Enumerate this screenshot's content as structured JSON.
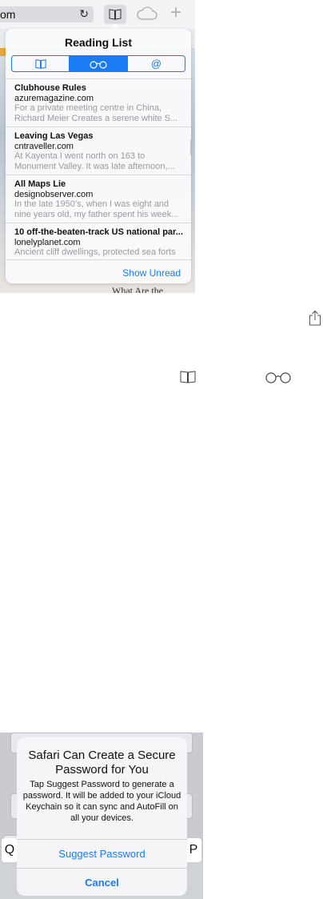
{
  "browser": {
    "url_text": "om",
    "reload_symbol": "↻"
  },
  "background": {
    "article_snippet": "What Are the"
  },
  "reading_list": {
    "title": "Reading List",
    "segments": [
      {
        "name": "bookmarks",
        "icon": "book-icon",
        "active": false
      },
      {
        "name": "reading-list",
        "icon": "glasses-icon",
        "active": true
      },
      {
        "name": "shared-links",
        "icon": "at-icon",
        "symbol": "@",
        "active": false
      }
    ],
    "items": [
      {
        "title": "Clubhouse Rules",
        "host": "azuremagazine.com",
        "desc_line1": "For a private meeting centre in China,",
        "desc_line2": "Richard Meier Creates a serene white S..."
      },
      {
        "title": "Leaving Las Vegas",
        "host": "cntraveller.com",
        "desc_line1": "At Kayenta I went north on 163 to",
        "desc_line2": "Monument Valley. It was late afternoon,..."
      },
      {
        "title": "All Maps Lie",
        "host": "designobserver.com",
        "desc_line1": "In the late 1950’s, when I was eight and",
        "desc_line2": "nine years old, my father spent his week..."
      },
      {
        "title": "10 off-the-beaten-track US national par...",
        "host": "lonelyplanet.com",
        "desc_line1": "Ancient cliff dwellings, protected sea forts",
        "desc_line2": ""
      }
    ],
    "show_unread_label": "Show Unread"
  },
  "password_alert": {
    "title": "Safari Can Create a Secure Password for You",
    "message": "Tap Suggest Password to generate a password. It will be added to your iCloud Keychain so it can sync and AutoFill on all your devices.",
    "suggest_label": "Suggest Password",
    "cancel_label": "Cancel"
  },
  "keyboard": {
    "key_left": "Q",
    "key_right": "P"
  },
  "colors": {
    "accent": "#1a7cf2"
  }
}
